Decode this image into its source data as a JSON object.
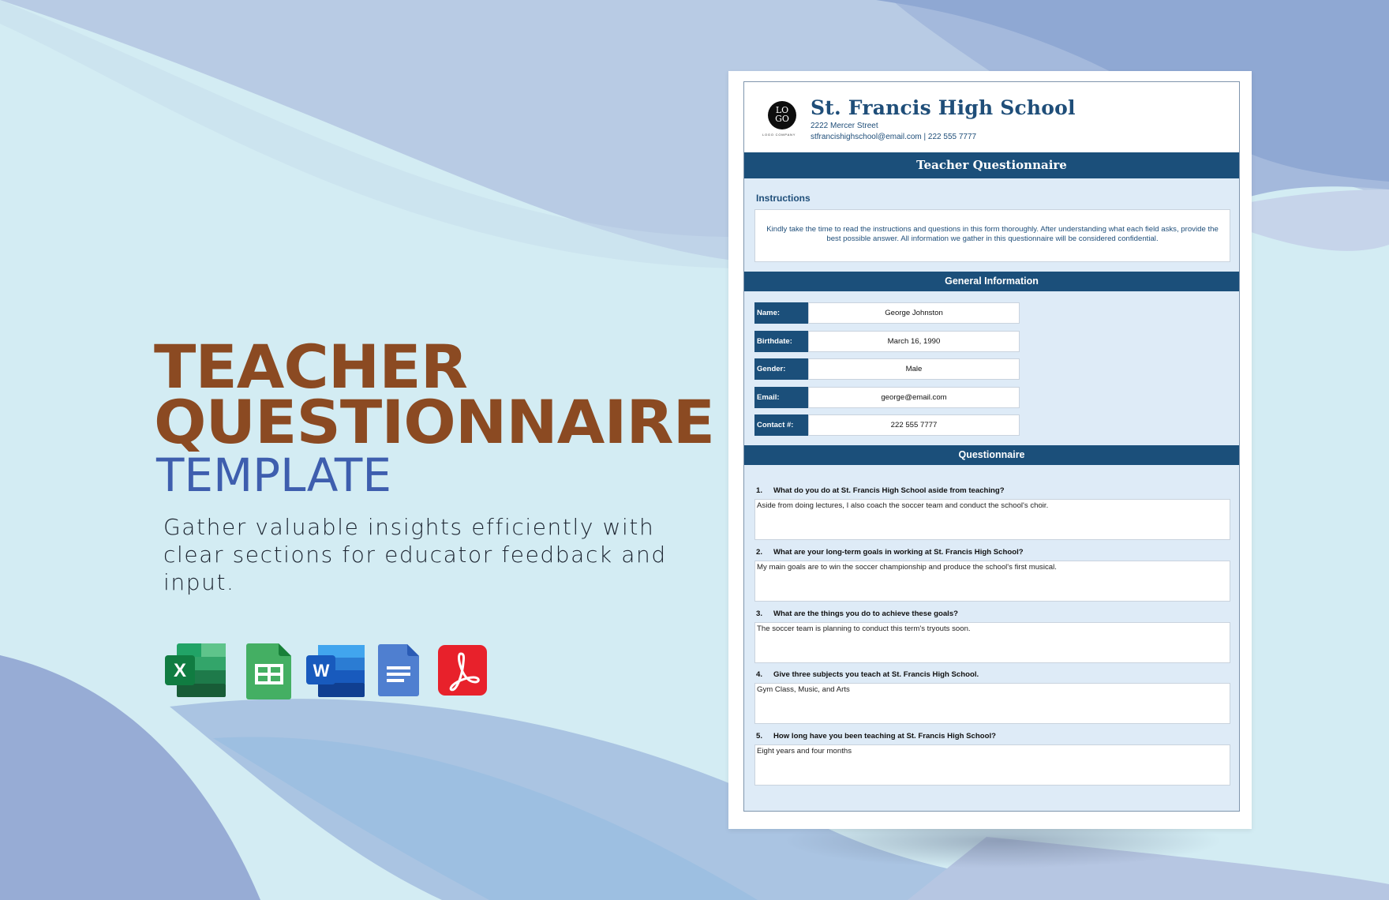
{
  "promo": {
    "title_line1": "TEACHER",
    "title_line2": "QUESTIONNAIRE",
    "subtitle": "TEMPLATE",
    "description": "Gather valuable insights efficiently with clear sections for educator feedback and input.",
    "formats": [
      {
        "name": "excel-icon",
        "letter": "X",
        "color": "#1f7244"
      },
      {
        "name": "google-sheets-icon",
        "letter": "",
        "color": "#23a566"
      },
      {
        "name": "word-icon",
        "letter": "W",
        "color": "#2b5797"
      },
      {
        "name": "google-docs-icon",
        "letter": "",
        "color": "#4c7dc8"
      },
      {
        "name": "pdf-icon",
        "letter": "",
        "color": "#e8212b"
      }
    ],
    "colors": {
      "title": "#8b4a22",
      "subtitle": "#3e5eae"
    }
  },
  "document": {
    "logo_text_top": "LO",
    "logo_text_bottom": "GO",
    "logo_sub": "LOGO COMPANY",
    "school_name": "St. Francis High School",
    "address": "2222 Mercer Street",
    "contact_line": "stfrancishighschool@email.com | 222 555 7777",
    "form_title": "Teacher Questionnaire",
    "instructions_label": "Instructions",
    "instructions_text": "Kindly take the time to read the instructions and questions in this form thoroughly. After understanding what each field asks, provide the best possible answer. All information we gather in this questionnaire will be considered confidential.",
    "general_info_title": "General Information",
    "general_info": [
      {
        "label": "Name:",
        "value": "George Johnston"
      },
      {
        "label": "Birthdate:",
        "value": "March 16, 1990"
      },
      {
        "label": "Gender:",
        "value": "Male"
      },
      {
        "label": "Email:",
        "value": "george@email.com"
      },
      {
        "label": "Contact #:",
        "value": "222 555 7777"
      }
    ],
    "questionnaire_title": "Questionnaire",
    "questions": [
      {
        "num": "1.",
        "question": "What do you do at St. Francis High School aside from teaching?",
        "answer": "Aside from doing lectures, I also coach the soccer team and conduct the school's choir."
      },
      {
        "num": "2.",
        "question": "What are your long-term goals in working at St. Francis High School?",
        "answer": "My main goals are to win the soccer championship and produce the school's first musical."
      },
      {
        "num": "3.",
        "question": "What are the things you do to achieve these goals?",
        "answer": "The soccer team is planning to conduct this term's tryouts soon."
      },
      {
        "num": "4.",
        "question": "Give three subjects you teach at St. Francis High School.",
        "answer": "Gym Class, Music, and Arts"
      },
      {
        "num": "5.",
        "question": "How long have you been teaching at St. Francis High School?",
        "answer": "Eight years and four months"
      }
    ],
    "colors": {
      "primary": "#1b4f7a",
      "panel": "#deebf7"
    }
  }
}
